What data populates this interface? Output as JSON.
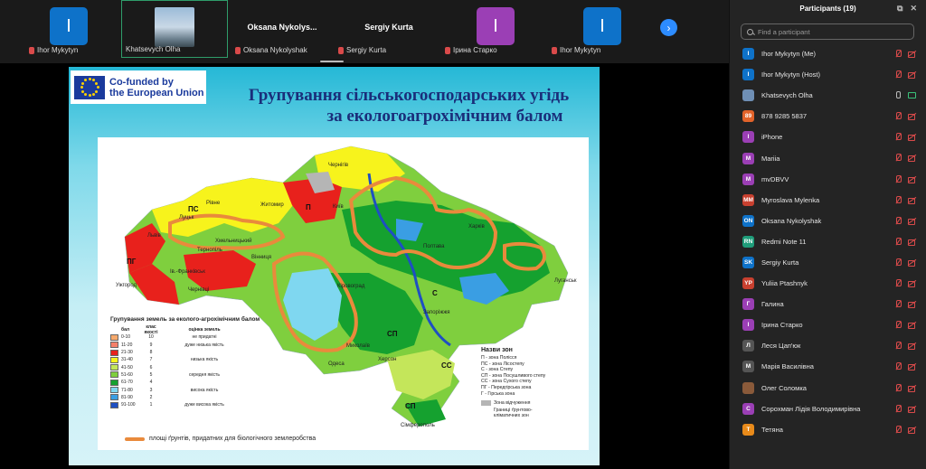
{
  "video_strip": {
    "tiles": [
      {
        "label": "Ihor Mykytyn",
        "initial": "I",
        "color": "#0e72c9",
        "display_name": ""
      },
      {
        "label": "Khatsevych Olha",
        "initial": "",
        "color": "",
        "display_name": ""
      },
      {
        "label": "Oksana Nykolyshak",
        "initial": "",
        "color": "",
        "display_name": "Oksana  Nykolys..."
      },
      {
        "label": "Sergiy Kurta",
        "initial": "",
        "color": "",
        "display_name": "Sergiy Kurta"
      },
      {
        "label": "Ірина Старко",
        "initial": "I",
        "color": "#9b3fb5",
        "display_name": ""
      },
      {
        "label": "Ihor Mykytyn",
        "initial": "I",
        "color": "#0e72c9",
        "display_name": ""
      }
    ],
    "next_icon": "chevron-right-icon"
  },
  "slide": {
    "eu_logo": {
      "line1": "Co-funded by",
      "line2": "the European Union"
    },
    "title_line1": "Групування сільськогосподарських угідь",
    "title_line2": "за екологоагрохімічним балом",
    "map_labels": {
      "kyiv": "Київ",
      "chernihiv": "Чернігів",
      "rivne": "Рівне",
      "lutsk": "Луцьк",
      "lviv": "Львів",
      "ternopil": "Тернопіль",
      "khmelnytskyi": "Хмельницький",
      "vinnytsia": "Вінниця",
      "uzhhorod": "Ужгород",
      "chernivtsi": "Чернівці",
      "kropyvnytskyi": "Кіровоград",
      "poltava": "Полтава",
      "kharkiv": "Харків",
      "luhansk": "Луганськ",
      "zaporizhzhia": "Запоріжжя",
      "mykolaiv": "Миколаїв",
      "odesa": "Одеса",
      "kherson": "Херсон",
      "simferopol": "Сімферополь",
      "ivano_frankivsk": "Ів.-Франківськ",
      "zhytomyr": "Житомир"
    },
    "zone_codes": {
      "p": "П",
      "ps": "ПС",
      "s": "С",
      "sp": "СП",
      "ss": "СС",
      "pg": "ПГ",
      "g": "Г"
    },
    "grouping_legend": {
      "title": "Групування земель за еколого-агрохімічним балом",
      "headers": [
        "бал",
        "клас якості",
        "оцінка земель"
      ],
      "rows": [
        {
          "score": "0-10",
          "cls": "10",
          "quality": "не придатні",
          "color": "#f6a96c"
        },
        {
          "score": "11-20",
          "cls": "9",
          "quality": "дуже низька якість",
          "color": "#f4806a"
        },
        {
          "score": "21-30",
          "cls": "8",
          "quality": "",
          "color": "#e8211c"
        },
        {
          "score": "31-40",
          "cls": "7",
          "quality": "низька якість",
          "color": "#f7f31c"
        },
        {
          "score": "41-50",
          "cls": "6",
          "quality": "",
          "color": "#c4e65a"
        },
        {
          "score": "51-60",
          "cls": "5",
          "quality": "середня якість",
          "color": "#7fcf3e"
        },
        {
          "score": "61-70",
          "cls": "4",
          "quality": "",
          "color": "#15a12f"
        },
        {
          "score": "71-80",
          "cls": "3",
          "quality": "висока якість",
          "color": "#7fd7f0"
        },
        {
          "score": "81-90",
          "cls": "2",
          "quality": "",
          "color": "#3a9ee3"
        },
        {
          "score": "91-100",
          "cls": "1",
          "quality": "дуже висока якість",
          "color": "#1e4fc2"
        }
      ]
    },
    "zones_legend": {
      "title": "Назви зон",
      "rows": [
        "П    - зона Полісся",
        "ПС  - зона Лісостепу",
        "С    - зона Степу",
        "СП  - зона Посушливого степу",
        "СС  - зона Сухого степу",
        "ПГ  - Передгірська зона",
        "Г    - Гірська зона"
      ],
      "alienated": "Зона відчуження",
      "borders": "Границі ґрунтово-\nкліматичних зон"
    },
    "bio_legend": "площі ґрунтів, придатних для біологічного землеробства"
  },
  "panel": {
    "title": "Participants (19)",
    "search_placeholder": "Find a participant",
    "participants": [
      {
        "name": "Ihor Mykytyn (Me)",
        "initials": "I",
        "color": "#0e72c9",
        "cam": "off",
        "mic": "muted"
      },
      {
        "name": "Ihor Mykytyn (Host)",
        "initials": "I",
        "color": "#0e72c9",
        "cam": "off",
        "mic": "muted"
      },
      {
        "name": "Khatsevych Olha",
        "initials": "",
        "color": "#6f8fb5",
        "cam": "on",
        "mic": "on"
      },
      {
        "name": "878 9285 5837",
        "initials": "89",
        "color": "#e2632a",
        "cam": "off",
        "mic": "muted"
      },
      {
        "name": "iPhone",
        "initials": "I",
        "color": "#9b3fb5",
        "cam": "off",
        "mic": "muted"
      },
      {
        "name": "Mariia",
        "initials": "M",
        "color": "#9b3fb5",
        "cam": "off",
        "mic": "muted"
      },
      {
        "name": "mvDBVV",
        "initials": "M",
        "color": "#9b3fb5",
        "cam": "off",
        "mic": "muted"
      },
      {
        "name": "Myroslava  Mylenka",
        "initials": "MM",
        "color": "#c8402f",
        "cam": "off",
        "mic": "muted"
      },
      {
        "name": "Oksana Nykolyshak",
        "initials": "ON",
        "color": "#0e72c9",
        "cam": "off",
        "mic": "muted"
      },
      {
        "name": "Redmi Note 11",
        "initials": "RN",
        "color": "#1f9d7a",
        "cam": "off",
        "mic": "muted"
      },
      {
        "name": "Sergiy Kurta",
        "initials": "SK",
        "color": "#0e72c9",
        "cam": "off",
        "mic": "muted"
      },
      {
        "name": "Yuliia Ptashnyk",
        "initials": "YP",
        "color": "#c8402f",
        "cam": "off",
        "mic": "muted"
      },
      {
        "name": "Галина",
        "initials": "Г",
        "color": "#9b3fb5",
        "cam": "off",
        "mic": "muted"
      },
      {
        "name": "Ірина Старко",
        "initials": "I",
        "color": "#9b3fb5",
        "cam": "off",
        "mic": "muted"
      },
      {
        "name": "Леся Цап'юк",
        "initials": "Л",
        "color": "#555",
        "cam": "off",
        "mic": "muted"
      },
      {
        "name": "Марія Василівна",
        "initials": "М",
        "color": "#555",
        "cam": "off",
        "mic": "muted"
      },
      {
        "name": "Олег Соломка",
        "initials": "",
        "color": "#8a5a3a",
        "cam": "off",
        "mic": "muted"
      },
      {
        "name": "Сорохман Лідія Володимирівна",
        "initials": "С",
        "color": "#9b3fb5",
        "cam": "off",
        "mic": "muted"
      },
      {
        "name": "Тетяна",
        "initials": "T",
        "color": "#e88a1a",
        "cam": "off",
        "mic": "muted"
      }
    ]
  }
}
